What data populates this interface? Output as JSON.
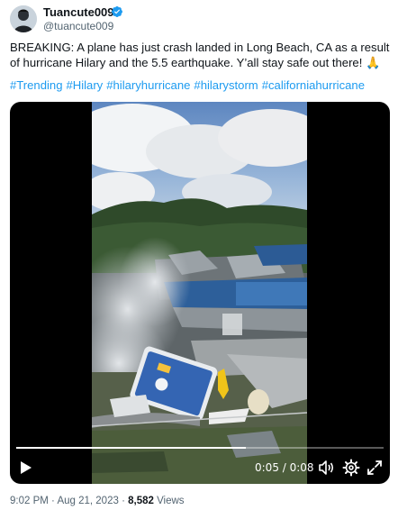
{
  "author": {
    "display_name": "Tuancute009",
    "handle": "@tuancute009",
    "verified_icon": "verified-badge-icon",
    "verified_color": "#1d9bf0"
  },
  "tweet": {
    "text": "BREAKING: A plane has just crash landed in Long Beach, CA as a result of hurricane Hilary and the 5.5 earthquake. Y’all stay safe out there!",
    "emoji": "🙏",
    "hashtags": [
      "#Trending",
      "#Hilary",
      "#hilaryhurricane",
      "#hilarystorm",
      "#californiahurricane"
    ],
    "hashtag_color": "#1d9bf0"
  },
  "video": {
    "time_display": "0:05 / 0:08",
    "progress": 0.625,
    "icons": {
      "play": "play-icon",
      "volume": "volume-icon",
      "settings": "settings-gear-icon",
      "fullscreen": "fullscreen-icon"
    }
  },
  "meta": {
    "time": "9:02 PM",
    "separator": "·",
    "date": "Aug 21, 2023",
    "views_count": "8,582",
    "views_label": "Views"
  }
}
